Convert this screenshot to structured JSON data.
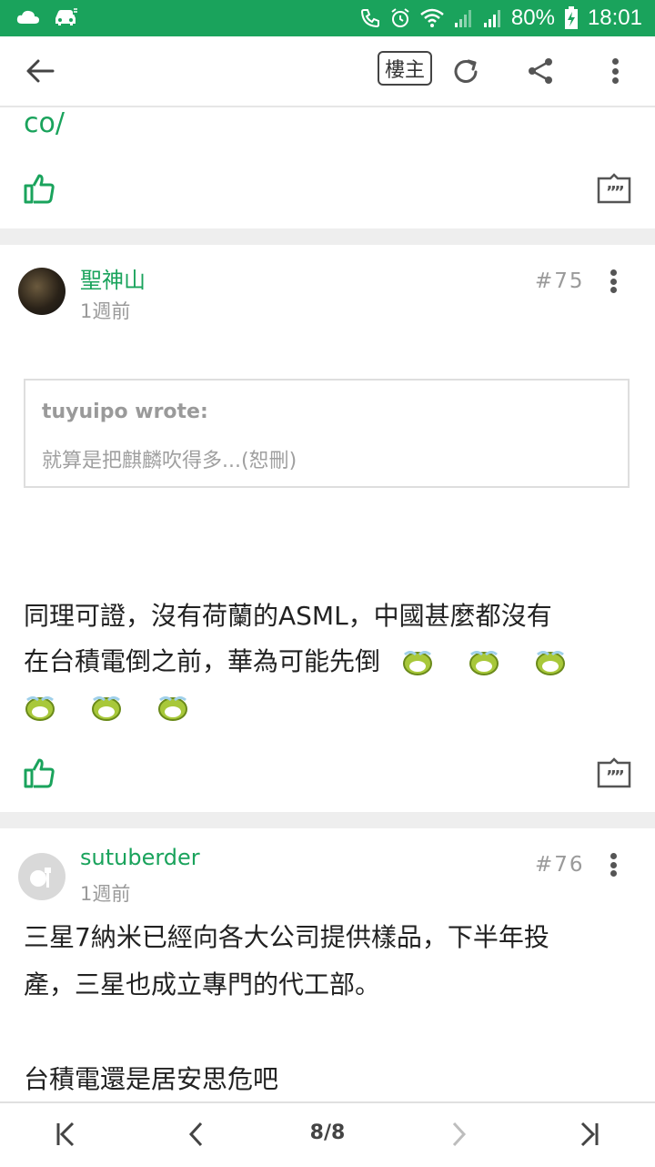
{
  "status_bar": {
    "battery_percent": "80%",
    "time": "18:01"
  },
  "toolbar": {
    "op_badge": "樓主"
  },
  "prev_post": {
    "continued_text": "co/"
  },
  "posts": [
    {
      "username": "聖神山",
      "time": "1週前",
      "floor": "#75",
      "quote": {
        "author": "tuyuipo wrote:",
        "text": "就算是把麒麟吹得多...(恕刪)"
      },
      "lines": [
        "同理可證，沒有荷蘭的ASML，中國甚麼都沒有",
        "在台積電倒之前，華為可能先倒"
      ],
      "emoticon_count": 6
    },
    {
      "username": "sutuberder",
      "time": "1週前",
      "floor": "#76",
      "lines": [
        "三星7納米已經向各大公司提供樣品，下半年投",
        "產，三星也成立專門的代工部。",
        "",
        "台積電還是居安思危吧"
      ]
    }
  ],
  "pagination": {
    "page_indicator": "8/8"
  },
  "colors": {
    "accent": "#1aa35c",
    "status_bar": "#1aa35c",
    "separator": "#eeeeee"
  }
}
